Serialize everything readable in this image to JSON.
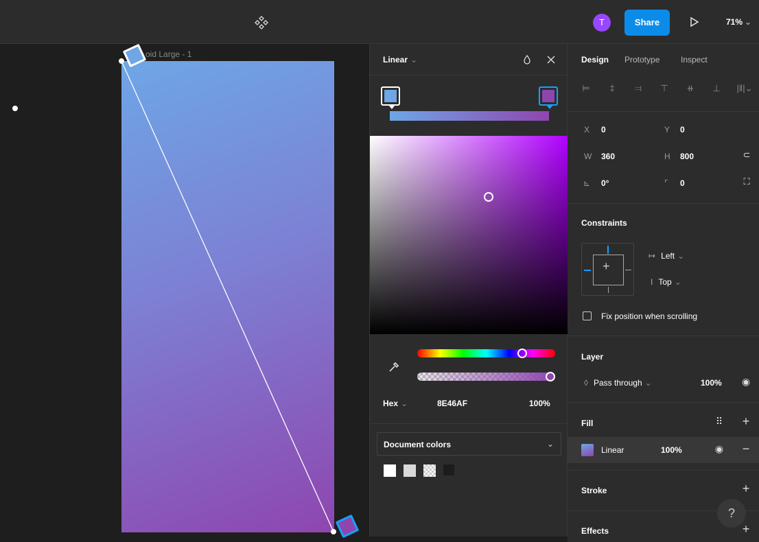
{
  "topbar": {
    "avatar_initial": "T",
    "share_label": "Share",
    "zoom": "71%"
  },
  "canvas": {
    "frame_label": "oid Large - 1"
  },
  "picker": {
    "type": "Linear",
    "hex_mode": "Hex",
    "hex_value": "8E46AF",
    "opacity": "100%",
    "document_colors_label": "Document colors",
    "stop_colors": [
      "#6ea6e6",
      "#8e46af"
    ],
    "swatches": [
      "#ffffff",
      "#d9d9d9",
      "#e8e8e8",
      "#222222"
    ]
  },
  "panel": {
    "tabs": [
      "Design",
      "Prototype",
      "Inspect"
    ],
    "x_label": "X",
    "x_value": "0",
    "y_label": "Y",
    "y_value": "0",
    "w_label": "W",
    "w_value": "360",
    "h_label": "H",
    "h_value": "800",
    "rotation": "0°",
    "radius": "0",
    "constraints_title": "Constraints",
    "constraint_h": "Left",
    "constraint_v": "Top",
    "fix_position_label": "Fix position when scrolling",
    "layer_title": "Layer",
    "blend_mode": "Pass through",
    "layer_opacity": "100%",
    "fill_title": "Fill",
    "fill_type": "Linear",
    "fill_opacity": "100%",
    "stroke_title": "Stroke",
    "effects_title": "Effects",
    "help": "?"
  }
}
